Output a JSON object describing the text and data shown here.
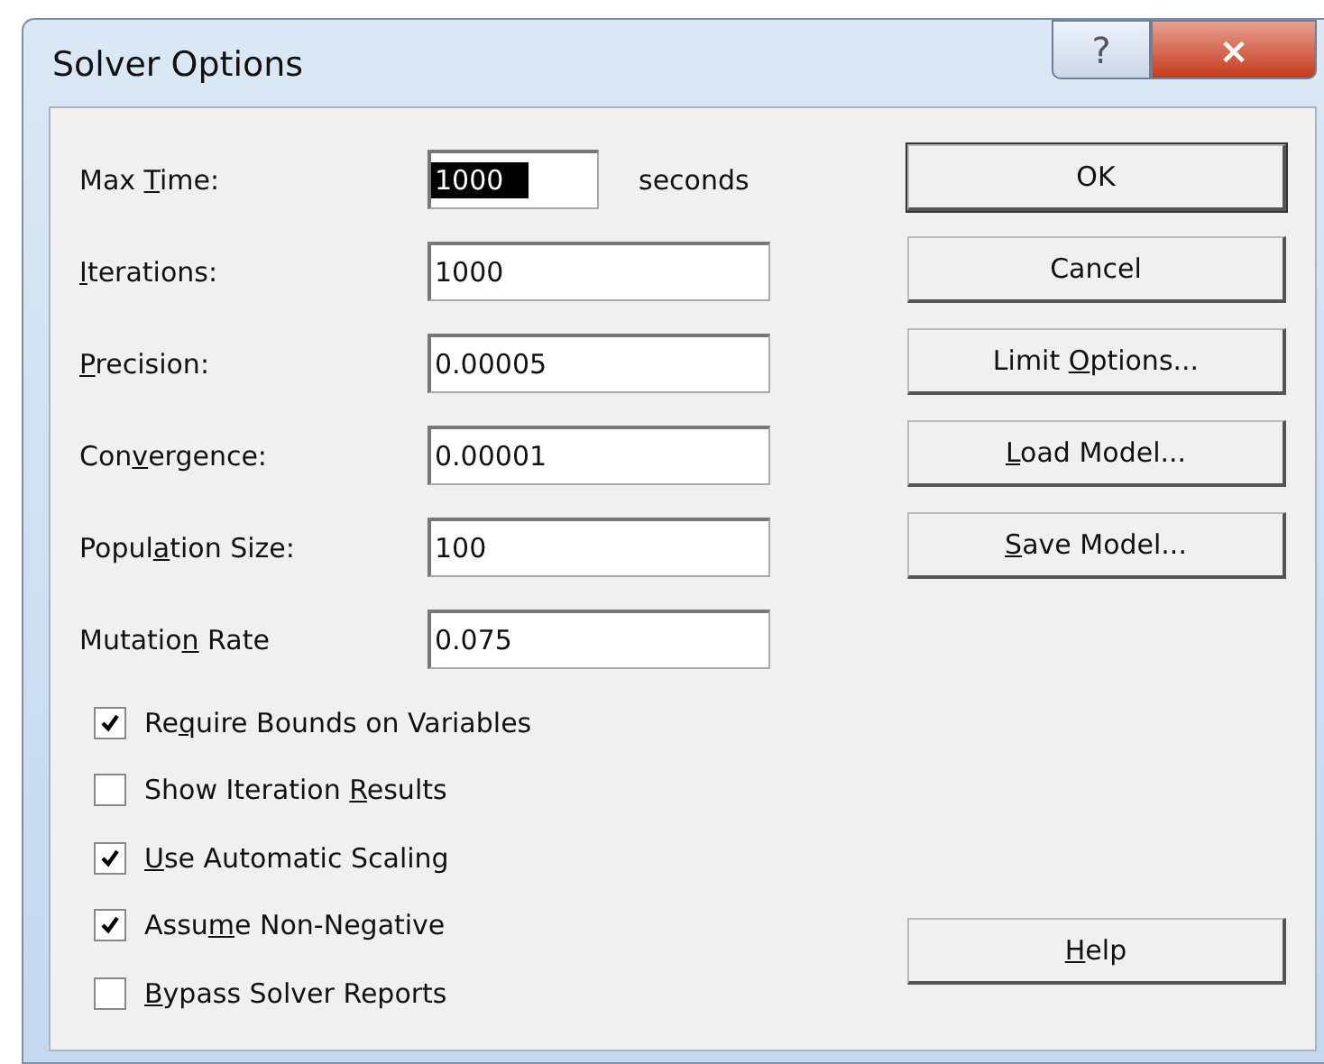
{
  "window": {
    "title": "Solver Options",
    "help_button": "?",
    "close_button": "×"
  },
  "fields": [
    {
      "label": {
        "before": "Max ",
        "key": "T",
        "after": "ime:"
      },
      "value": "1000",
      "selected": true,
      "unit": "seconds"
    },
    {
      "label": {
        "key": "I",
        "after": "terations:"
      },
      "value": "1000",
      "selected": false
    },
    {
      "label": {
        "key": "P",
        "after": "recision:"
      },
      "value": "0.00005",
      "selected": false
    },
    {
      "label": {
        "before": "Con",
        "key": "v",
        "after": "ergence:"
      },
      "value": "0.00001",
      "selected": false
    },
    {
      "label": {
        "before": "Popul",
        "key": "a",
        "after": "tion Size:"
      },
      "value": "100",
      "selected": false
    },
    {
      "label": {
        "before": "Mutatio",
        "key": "n",
        "after": " Rate"
      },
      "value": "0.075",
      "selected": false
    }
  ],
  "checkboxes": [
    {
      "label": {
        "before": "Re",
        "key": "q",
        "after": "uire Bounds on Variables"
      },
      "checked": true
    },
    {
      "label": {
        "before": "Show Iteration ",
        "key": "R",
        "after": "esults"
      },
      "checked": false
    },
    {
      "label": {
        "key": "U",
        "after": "se Automatic Scaling"
      },
      "checked": true
    },
    {
      "label": {
        "before": "Assu",
        "key": "m",
        "after": "e Non-Negative"
      },
      "checked": true
    },
    {
      "label": {
        "key": "B",
        "after": "ypass Solver Reports"
      },
      "checked": false
    }
  ],
  "buttons": [
    {
      "label": {
        "before": "OK"
      },
      "default": true
    },
    {
      "label": {
        "before": "Cancel"
      },
      "default": false
    },
    {
      "label": {
        "before": "Limit ",
        "key": "O",
        "after": "ptions..."
      },
      "default": false
    },
    {
      "label": {
        "key": "L",
        "after": "oad Model..."
      },
      "default": false
    },
    {
      "label": {
        "key": "S",
        "after": "ave Model..."
      },
      "default": false
    }
  ],
  "help": {
    "label": {
      "key": "H",
      "after": "elp"
    }
  }
}
